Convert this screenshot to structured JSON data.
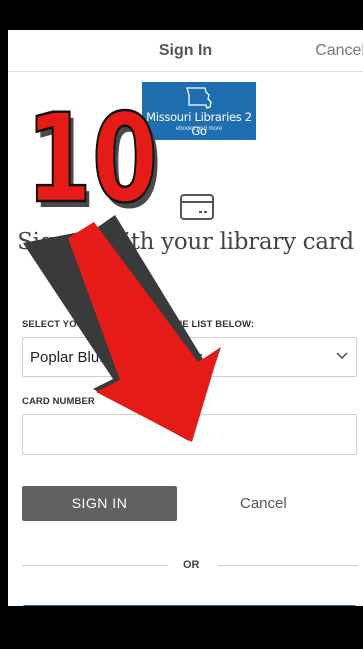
{
  "navbar": {
    "title": "Sign In",
    "cancel_label": "Cancel"
  },
  "logo": {
    "title": "Missouri Libraries 2 Go",
    "subtitle": "ebooks and more"
  },
  "main": {
    "heading": "Sign in with your library card",
    "select_label": "SELECT YOUR LIBRARY FROM THE LIST BELOW:",
    "select_value": "Poplar Bluff Public Library",
    "card_label": "CARD NUMBER",
    "card_value": "",
    "signin_label": "SIGN IN",
    "cancel_label": "Cancel",
    "or_label": "OR"
  },
  "annotation": {
    "step_number": "10",
    "color": "#e41b17",
    "arrow_icon": "red-arrow"
  },
  "colors": {
    "logo_bg": "#1f6fb0",
    "button_bg": "#616161",
    "accent_border": "#2d6da8"
  }
}
